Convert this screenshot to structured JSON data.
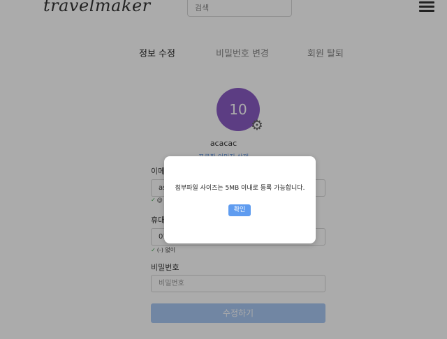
{
  "header": {
    "logo_text": "travelmaker",
    "search_placeholder": "검색",
    "menu_icon": "hamburger-menu-icon"
  },
  "tabs": [
    {
      "label": "정보 수정",
      "active": true
    },
    {
      "label": "비밀번호 변경",
      "active": false
    },
    {
      "label": "회원 탈퇴",
      "active": false
    }
  ],
  "profile": {
    "avatar_text": "10",
    "avatar_color": "#8a5cc4",
    "username": "acacac",
    "delete_image_link": "프로필 이미지 삭제",
    "settings_icon": "gear-icon"
  },
  "form": {
    "email_label": "이메일",
    "email_value": "as",
    "email_hint": "@",
    "phone_label": "휴대",
    "phone_value": "01",
    "phone_hint": "(-) 없이",
    "password_label": "비밀번호",
    "password_placeholder": "비밀번호",
    "submit_label": "수정하기"
  },
  "modal": {
    "message": "첨부파일 사이즈는 5MB 이내로 등록 가능합니다.",
    "confirm_label": "확인"
  },
  "colors": {
    "accent": "#5f9cf0",
    "submit_disabled": "#a9c8f3",
    "check": "#3aa14a"
  }
}
